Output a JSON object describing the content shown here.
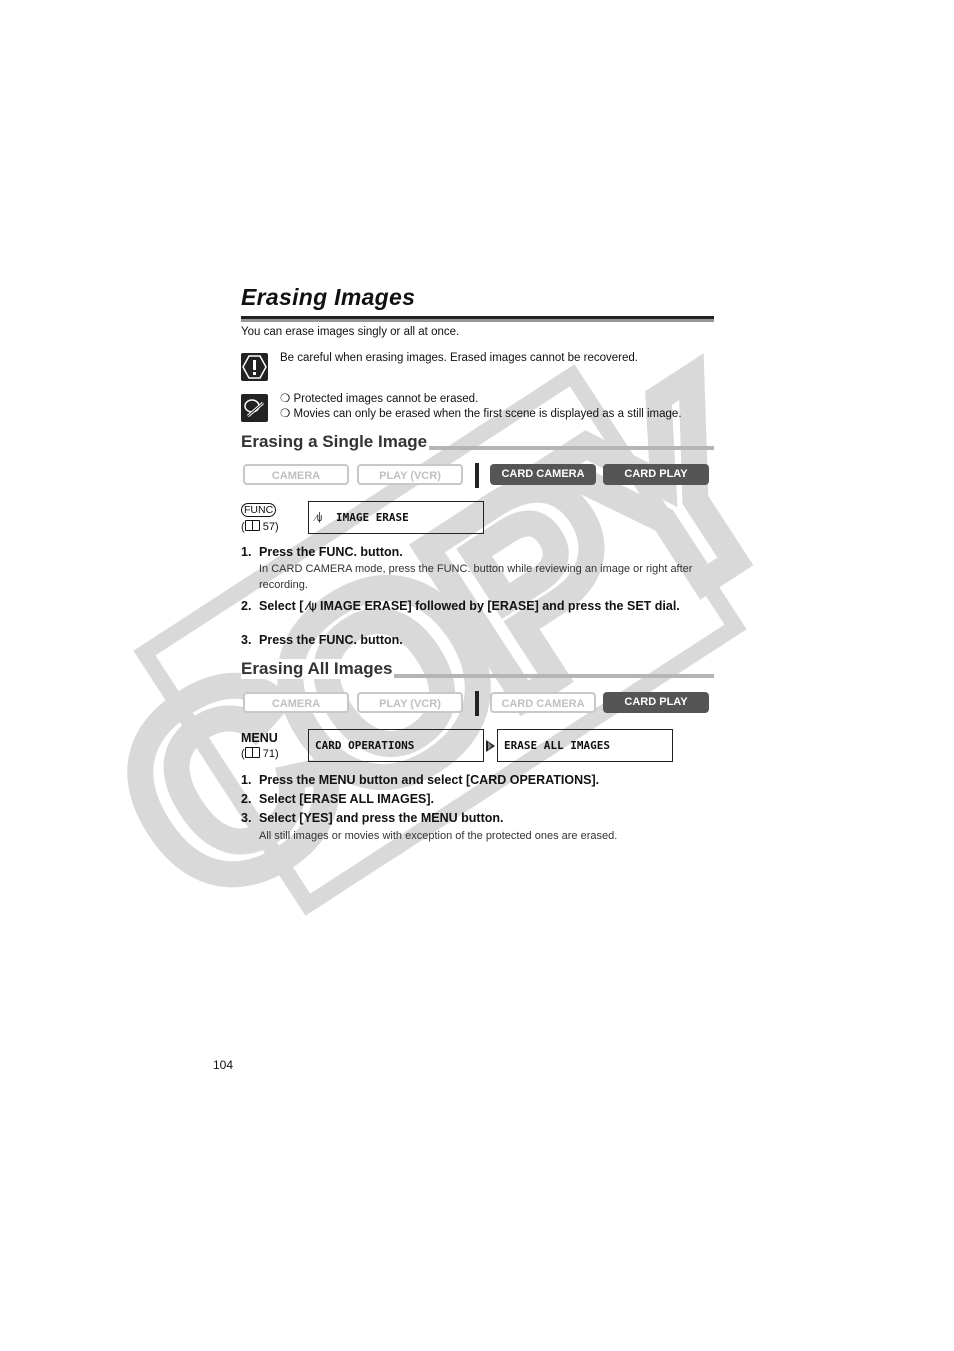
{
  "page": {
    "title": "Erasing Images",
    "intro": "You can erase images singly or all at once.",
    "caution_text": "Be careful when erasing images. Erased images cannot be recovered.",
    "notes": [
      "Protected images cannot be erased.",
      "Movies can only be erased when the first scene is displayed as a still image."
    ],
    "note_bullet": "❍",
    "page_number": "104",
    "watermark": "COPY"
  },
  "single": {
    "heading": "Erasing a Single Image",
    "modes": [
      {
        "label": "CAMERA",
        "active": false
      },
      {
        "label": "PLAY (VCR)",
        "active": false
      },
      {
        "label": "CARD CAMERA",
        "active": true
      },
      {
        "label": "CARD PLAY",
        "active": true
      }
    ],
    "button_label": "FUNC",
    "ref_page": "57",
    "lcd_icon": "⁄⍦",
    "lcd_text": "IMAGE ERASE",
    "steps": [
      {
        "num": "1.",
        "text": "Press the FUNC. button.",
        "sub": "In CARD CAMERA mode, press the FUNC. button while reviewing an image or right after recording."
      },
      {
        "num": "2.",
        "text": "Select [ ⁄⍦ IMAGE ERASE] followed by [ERASE] and press the SET dial.",
        "sub": ""
      },
      {
        "num": "3.",
        "text": "Press the FUNC. button.",
        "sub": ""
      }
    ]
  },
  "all": {
    "heading": "Erasing All Images",
    "modes": [
      {
        "label": "CAMERA",
        "active": false
      },
      {
        "label": "PLAY (VCR)",
        "active": false
      },
      {
        "label": "CARD CAMERA",
        "active": false
      },
      {
        "label": "CARD PLAY",
        "active": true
      }
    ],
    "button_label": "MENU",
    "ref_page": "71",
    "lcd_items": [
      "CARD OPERATIONS",
      "ERASE ALL IMAGES"
    ],
    "steps": [
      {
        "num": "1.",
        "text": "Press the MENU button and select [CARD OPERATIONS].",
        "sub": ""
      },
      {
        "num": "2.",
        "text": "Select [ERASE ALL IMAGES].",
        "sub": ""
      },
      {
        "num": "3.",
        "text": "Select [YES] and press the MENU button.",
        "sub": "All still images or movies with exception of the protected ones are erased."
      }
    ]
  }
}
